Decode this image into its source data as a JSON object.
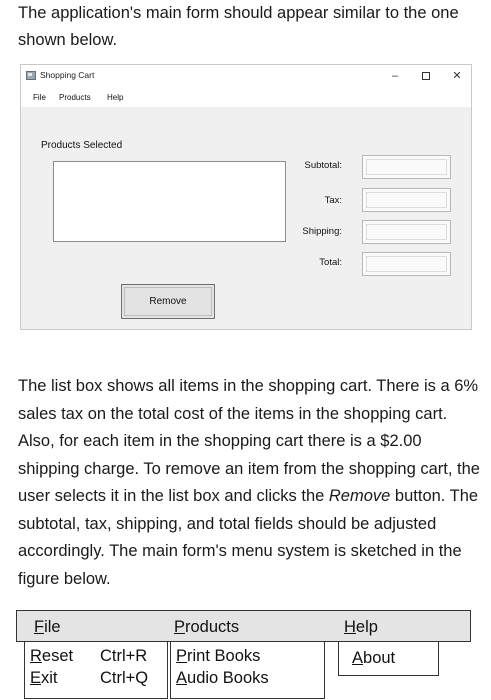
{
  "intro_text": "The application's main form should appear similar to the one shown below.",
  "window": {
    "title": "Shopping Cart",
    "controls": {
      "minimize": "–",
      "close": "✕"
    },
    "menu": [
      "File",
      "Products",
      "Help"
    ],
    "group_label": "Products Selected",
    "fields": [
      {
        "label": "Subtotal:",
        "value": ""
      },
      {
        "label": "Tax:",
        "value": ""
      },
      {
        "label": "Shipping:",
        "value": ""
      },
      {
        "label": "Total:",
        "value": ""
      }
    ],
    "remove_button": "Remove"
  },
  "description": {
    "part1": "The list box shows all items in the shopping cart. There is a 6% sales tax on the total cost of the items in the shopping cart. Also, for each item in the shopping cart there is a $2.00 shipping charge. To remove an item from the shopping cart, the user selects it in the list box and clicks the ",
    "emphasis": "Remove",
    "part2": " button. The subtotal, tax, shipping, and total fields should be adjusted accordingly. The main form's menu system is sketched in the figure below."
  },
  "menu_sketch": {
    "file": {
      "mnemonic": "F",
      "rest": "ile",
      "items": [
        {
          "mnemonic": "R",
          "rest": "eset",
          "shortcut": "Ctrl+R"
        },
        {
          "mnemonic": "E",
          "rest": "xit",
          "shortcut": "Ctrl+Q"
        }
      ]
    },
    "products": {
      "mnemonic": "P",
      "rest": "roducts",
      "items": [
        {
          "mnemonic": "P",
          "rest": "rint Books"
        },
        {
          "mnemonic": "A",
          "rest": "udio Books"
        }
      ]
    },
    "help": {
      "mnemonic": "H",
      "rest": "elp",
      "items": [
        {
          "mnemonic": "A",
          "rest": "bout"
        }
      ]
    }
  }
}
